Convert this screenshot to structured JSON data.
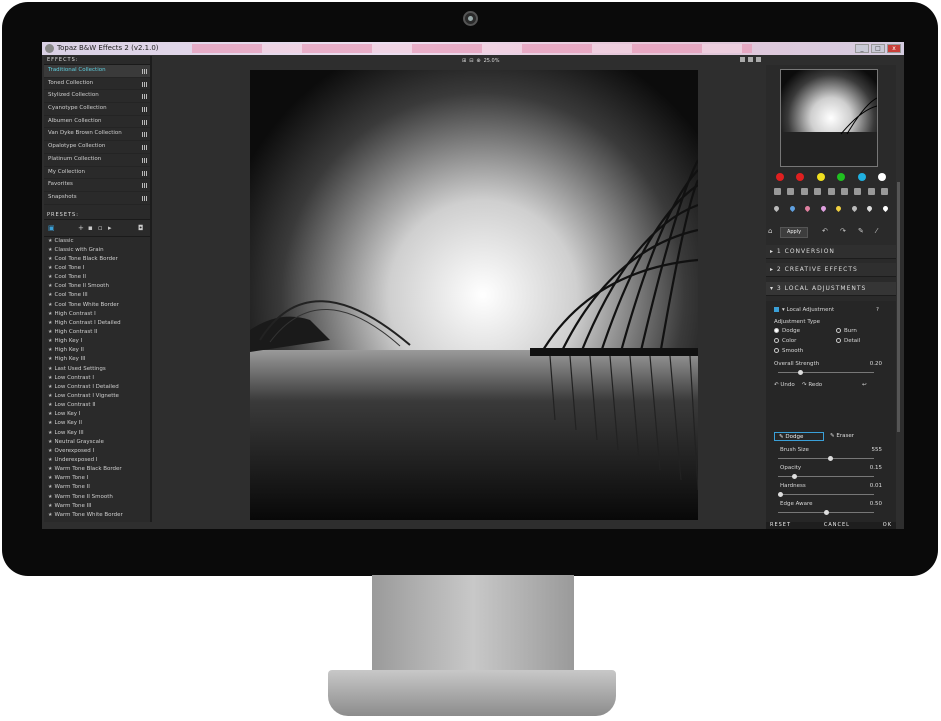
{
  "window": {
    "title": "Topaz B&W Effects 2 (v2.1.0)",
    "min": "_",
    "max": "□",
    "close": "x"
  },
  "zoom": {
    "label": "25.0%"
  },
  "effects": {
    "header": "EFFECTS:",
    "collections": [
      "Traditional Collection",
      "Toned Collection",
      "Stylized Collection",
      "Cyanotype Collection",
      "Albumen Collection",
      "Van Dyke Brown Collection",
      "Opalotype Collection",
      "Platinum Collection",
      "My Collection",
      "Favorites",
      "Snapshots"
    ]
  },
  "presets": {
    "header": "PRESETS:",
    "items": [
      "Classic",
      "Classic with Grain",
      "Cool Tone Black Border",
      "Cool Tone I",
      "Cool Tone II",
      "Cool Tone II Smooth",
      "Cool Tone III",
      "Cool Tone White Border",
      "High Contrast I",
      "High Contrast I Detailed",
      "High Contrast II",
      "High Key I",
      "High Key II",
      "High Key III",
      "Last Used Settings",
      "Low Contrast I",
      "Low Contrast I Detailed",
      "Low Contrast I Vignette",
      "Low Contrast II",
      "Low Key I",
      "Low Key II",
      "Low Key III",
      "Neutral Grayscale",
      "Overexposed I",
      "Underexposed I",
      "Warm Tone Black Border",
      "Warm Tone I",
      "Warm Tone II",
      "Warm Tone II Smooth",
      "Warm Tone III",
      "Warm Tone White Border"
    ]
  },
  "colors": {
    "accent": "#3aa0d8",
    "selected_text": "#5fd0e0"
  },
  "color_dots": [
    "#e02020",
    "#e02020",
    "#f0e020",
    "#20c020",
    "#20b0e0",
    "#ffffff"
  ],
  "right": {
    "apply": "Apply",
    "sections": [
      "1 CONVERSION",
      "2 CREATIVE EFFECTS",
      "3 LOCAL ADJUSTMENTS"
    ],
    "local": {
      "title": "Local Adjustment",
      "help": "?",
      "adjustment_type": "Adjustment Type",
      "dodge": "Dodge",
      "burn": "Burn",
      "color": "Color",
      "detail": "Detail",
      "smooth": "Smooth",
      "overall_strength": "Overall Strength",
      "overall_strength_val": "0.20",
      "undo": "Undo",
      "redo": "Redo",
      "dodge_btn": "Dodge",
      "eraser_btn": "Eraser",
      "brush_size": "Brush Size",
      "brush_size_val": "555",
      "opacity": "Opacity",
      "opacity_val": "0.15",
      "hardness": "Hardness",
      "hardness_val": "0.01",
      "edge_aware": "Edge Aware",
      "edge_aware_val": "0.50"
    }
  },
  "bottom": {
    "reset": "RESET",
    "cancel": "CANCEL",
    "ok": "OK"
  }
}
